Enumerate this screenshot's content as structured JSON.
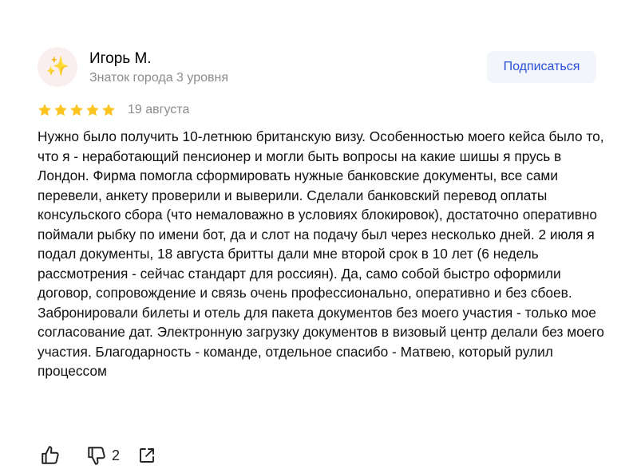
{
  "author": {
    "avatar_icon": "sparkles-icon",
    "name": "Игорь М.",
    "level": "Знаток города 3 уровня"
  },
  "subscribe_label": "Подписаться",
  "rating": {
    "stars": 5,
    "max": 5,
    "color": "#fcc521"
  },
  "date": "19 августа",
  "text": "Нужно было получить 10-летнюю британскую визу. Особенностью моего кейса было то, что я - неработающий пенсионер и могли быть вопросы на какие шишы я прусь в Лондон. Фирма помогла сформировать нужные банковские документы, все сами перевели, анкету проверили и выверили. Сделали банковский перевод оплаты консульского сбора (что немаловажно в условиях блокировок), достаточно оперативно поймали рыбку по имени бот, да и слот на подачу был через несколько дней. 2 июля я подал документы, 18 августа бритты дали мне второй срок в 10 лет (6 недель рассмотрения - сейчас стандарт для россиян). Да, само собой быстро оформили договор, сопровождение и связь очень профессионально, оперативно и без сбоев. Забронировали билеты и отель для пакета документов без моего участия - только мое согласование дат. Электронную загрузку документов в визовый центр делали без моего участия. Благодарность - команде, отдельное спасибо - Матвею, который рулил процессом",
  "actions": {
    "like_icon": "thumbs-up-icon",
    "dislike_icon": "thumbs-down-icon",
    "dislike_count": "2",
    "share_icon": "share-icon"
  }
}
